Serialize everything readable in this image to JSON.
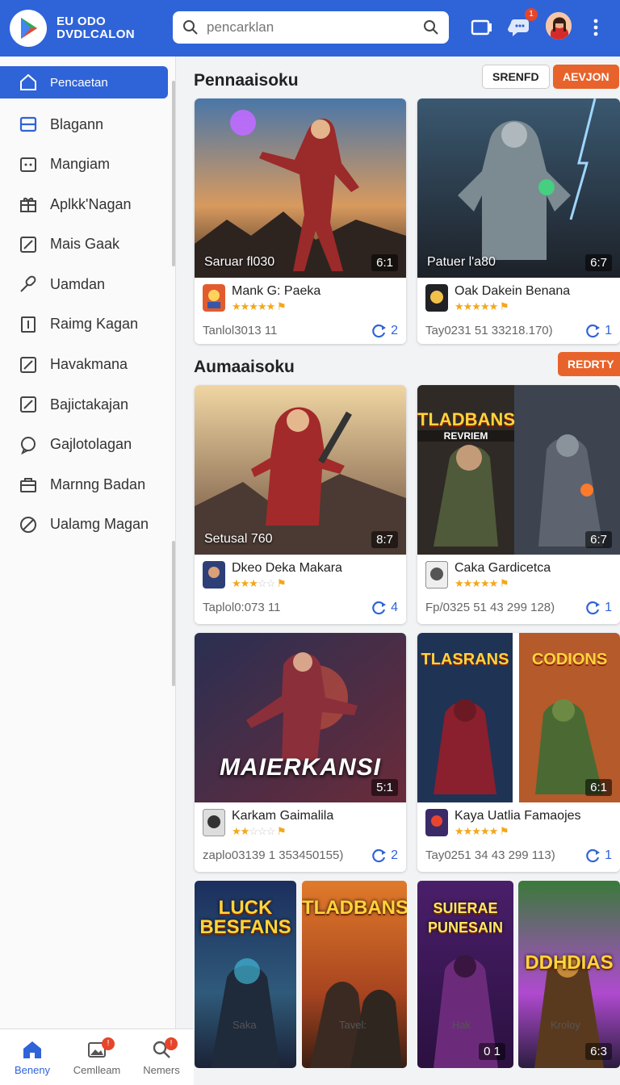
{
  "app": {
    "brand_line1": "EU ODO",
    "brand_line2": "DVDLCALON"
  },
  "search": {
    "placeholder": "pencarklan"
  },
  "header": {
    "badge_count": "1"
  },
  "sidebar": {
    "items": [
      {
        "label": "Pencaetan",
        "icon": "home-icon"
      },
      {
        "label": "Blagann",
        "icon": "card-icon"
      },
      {
        "label": "Mangiam",
        "icon": "box-icon"
      },
      {
        "label": "Aplkk'Nagan",
        "icon": "gift-icon"
      },
      {
        "label": "Mais Gaak",
        "icon": "edit-icon"
      },
      {
        "label": "Uamdan",
        "icon": "link-icon"
      },
      {
        "label": "Raimg Kagan",
        "icon": "bars-icon"
      },
      {
        "label": "Havakmana",
        "icon": "edit-icon"
      },
      {
        "label": "Bajictakajan",
        "icon": "edit-icon"
      },
      {
        "label": "Gajlotolagan",
        "icon": "bubble-icon"
      },
      {
        "label": "Marnng Badan",
        "icon": "bag-icon"
      },
      {
        "label": "Ualamg Magan",
        "icon": "block-icon"
      }
    ]
  },
  "bottomnav": [
    {
      "label": "Beneny",
      "icon": "home-icon"
    },
    {
      "label": "Cemlleam",
      "icon": "image-icon",
      "badge": "!"
    },
    {
      "label": "Nemers",
      "icon": "search-icon",
      "badge": "!"
    }
  ],
  "section1": {
    "title": "Pennaaisoku",
    "chip_left": "SRENFD",
    "chip_right": "AEVJON"
  },
  "section2": {
    "title": "Aumaaisoku",
    "chip_right": "REDRTY"
  },
  "cards": [
    {
      "art_caption": "Saruar fl030",
      "art_tag": "6:1",
      "name": "Mank G: Paeka",
      "stars": 5,
      "sub": "Tanlol3013 11",
      "count": "2"
    },
    {
      "art_caption": "Patuer l'a80",
      "art_tag": "6:7",
      "name": "Oak Dakein Benana",
      "stars": 5,
      "sub": "Tay0231 51 33218.170)",
      "count": "1"
    },
    {
      "art_caption": "Setusal 760",
      "art_tag": "8:7",
      "name": "Dkeo Deka Makara",
      "stars": 3,
      "sub": "Taplol0:073 11",
      "count": "4"
    },
    {
      "art_caption": "",
      "art_tag": "6:7",
      "name": "Caka Gardicetca",
      "stars": 5,
      "sub": "Fp/0325 51 43 299 128)",
      "count": "1",
      "art_title": "TLADBANS",
      "art_subtitle": "REVRIEM"
    },
    {
      "art_caption": "",
      "art_tag": "5:1",
      "name": "Karkam Gaimalila",
      "stars": 2,
      "sub": "zaplo03139 1 353450155)",
      "count": "2",
      "art_title": "MAIERKANSI"
    },
    {
      "art_caption": "",
      "art_tag": "6:1",
      "name": "Kaya Uatlia Famaojes",
      "stars": 5,
      "sub": "Tay0251 34 43 299 113)",
      "count": "1",
      "art_title": "TLASRANS",
      "art_title2": "CODIONS"
    }
  ],
  "posters": [
    {
      "title": "LUCK BESFANS",
      "label": "Saka"
    },
    {
      "title": "TLADBANS",
      "label": "Tavel:"
    },
    {
      "title": "SUIERAE PUNESAIN",
      "label": "Hak",
      "tag": "0 1"
    },
    {
      "title": "DDHDIAS",
      "label": "Kroloy",
      "tag": "6:3"
    }
  ],
  "colors": {
    "primary": "#2f63d8",
    "accent": "#e8632b",
    "star": "#f2a71b"
  }
}
